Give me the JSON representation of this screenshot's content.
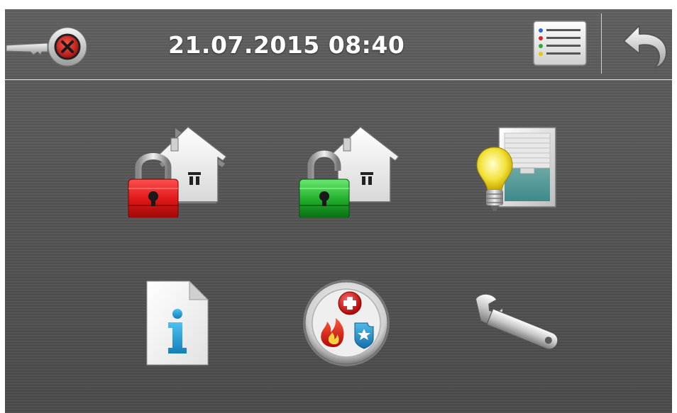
{
  "topbar": {
    "datetime": "21.07.2015 08:40",
    "key_status_icon": "key-disconnected-icon",
    "list_icon": "event-list-icon",
    "back_icon": "back-arrow-icon"
  },
  "tiles": [
    {
      "name": "arm",
      "icon": "locked-house-icon",
      "accent": "#e02020"
    },
    {
      "name": "disarm",
      "icon": "unlocked-house-icon",
      "accent": "#22a832"
    },
    {
      "name": "control",
      "icon": "lightbulb-blind-icon",
      "accent": "#f2e23a"
    },
    {
      "name": "info",
      "icon": "info-document-icon",
      "accent": "#1e9bd7"
    },
    {
      "name": "emergency",
      "icon": "emergency-badge-icon",
      "accent": "#d9242a"
    },
    {
      "name": "service",
      "icon": "wrench-icon",
      "accent": "#c8c8c8"
    }
  ]
}
